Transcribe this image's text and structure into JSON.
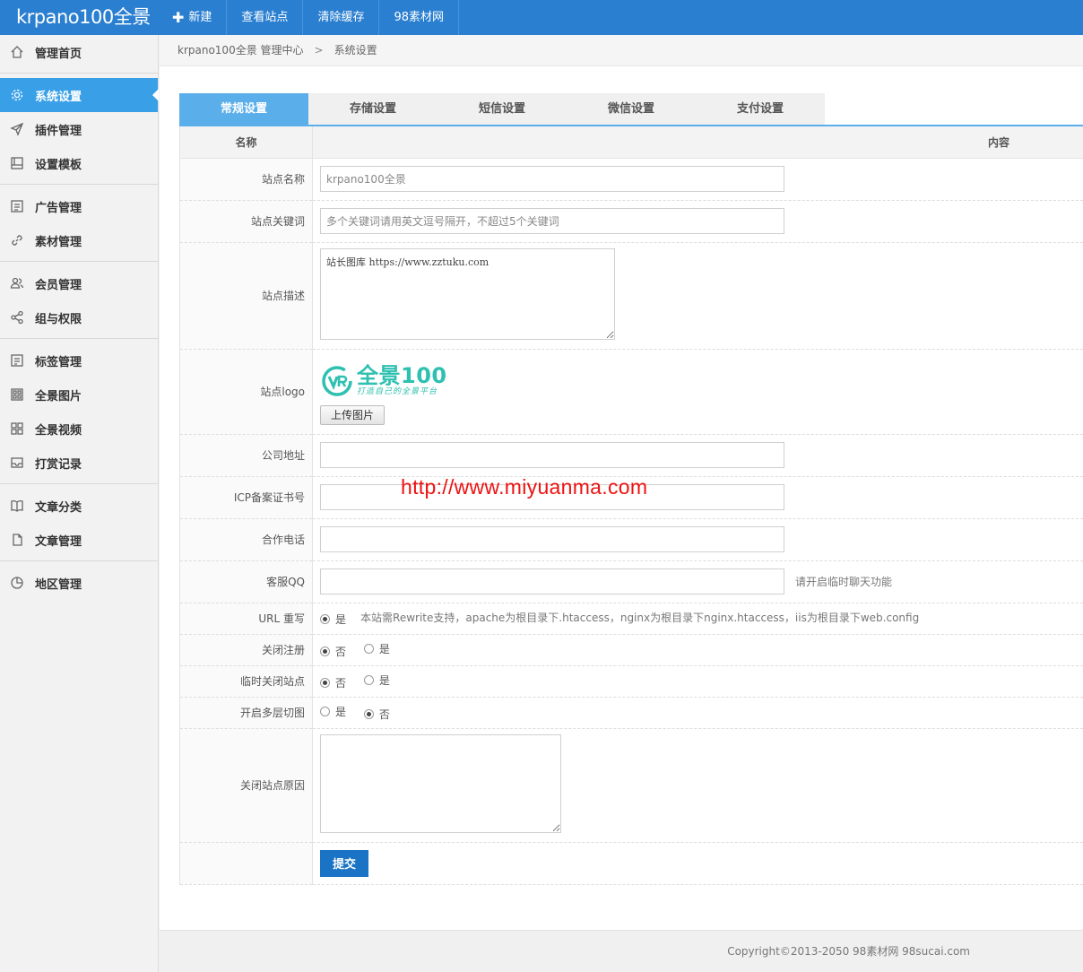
{
  "header": {
    "brand": "krpano100全景",
    "nav": [
      {
        "label": "新建",
        "icon": "plus-icon"
      },
      {
        "label": "查看站点"
      },
      {
        "label": "清除缓存"
      },
      {
        "label": "98素材网"
      }
    ]
  },
  "sidebar": {
    "items": [
      {
        "label": "管理首页",
        "icon": "home-icon"
      },
      {
        "label": "系统设置",
        "icon": "gear-icon",
        "active": true
      },
      {
        "label": "插件管理",
        "icon": "send-icon"
      },
      {
        "label": "设置模板",
        "icon": "template-icon"
      },
      {
        "label": "广告管理",
        "icon": "ad-icon"
      },
      {
        "label": "素材管理",
        "icon": "link-icon"
      },
      {
        "label": "会员管理",
        "icon": "users-icon"
      },
      {
        "label": "组与权限",
        "icon": "share-icon"
      },
      {
        "label": "标签管理",
        "icon": "tag-icon"
      },
      {
        "label": "全景图片",
        "icon": "grid-icon"
      },
      {
        "label": "全景视频",
        "icon": "apps-icon"
      },
      {
        "label": "打赏记录",
        "icon": "inbox-icon"
      },
      {
        "label": "文章分类",
        "icon": "book-icon"
      },
      {
        "label": "文章管理",
        "icon": "file-icon"
      },
      {
        "label": "地区管理",
        "icon": "pie-icon"
      }
    ]
  },
  "breadcrumb": {
    "home": "krpano100全景 管理中心",
    "separator": ">",
    "current": "系统设置"
  },
  "tabs": [
    {
      "label": "常规设置",
      "active": true
    },
    {
      "label": "存储设置"
    },
    {
      "label": "短信设置"
    },
    {
      "label": "微信设置"
    },
    {
      "label": "支付设置"
    }
  ],
  "table": {
    "col_name": "名称",
    "col_content": "内容"
  },
  "form": {
    "site_name": {
      "label": "站点名称",
      "placeholder": "krpano100全景"
    },
    "site_keywords": {
      "label": "站点关键词",
      "placeholder": "多个关键词请用英文逗号隔开，不超过5个关键词"
    },
    "site_desc": {
      "label": "站点描述",
      "value": "站长图库 https://www.zztuku.com"
    },
    "site_logo": {
      "label": "站点logo",
      "logo_main": "全景100",
      "logo_sub": "打造自己的全景平台",
      "upload_label": "上传图片"
    },
    "company_address": {
      "label": "公司地址",
      "value": ""
    },
    "icp": {
      "label": "ICP备案证书号",
      "value": ""
    },
    "phone": {
      "label": "合作电话",
      "value": ""
    },
    "qq": {
      "label": "客服QQ",
      "value": "",
      "hint": "请开启临时聊天功能"
    },
    "url_rewrite": {
      "label": "URL 重写",
      "option_yes": "是",
      "hint": "本站需Rewrite支持，apache为根目录下.htaccess，nginx为根目录下nginx.htaccess，iis为根目录下web.config"
    },
    "close_register": {
      "label": "关闭注册",
      "option_no": "否",
      "option_yes": "是"
    },
    "temp_close": {
      "label": "临时关闭站点",
      "option_no": "否",
      "option_yes": "是"
    },
    "multi_cut": {
      "label": "开启多层切图",
      "option_yes": "是",
      "option_no": "否"
    },
    "close_reason": {
      "label": "关闭站点原因",
      "value": ""
    },
    "submit_label": "提交"
  },
  "watermark": "http://www.miyuanma.com",
  "footer": {
    "copyright": "Copyright©2013-2050   98素材网 98sucai.com"
  }
}
